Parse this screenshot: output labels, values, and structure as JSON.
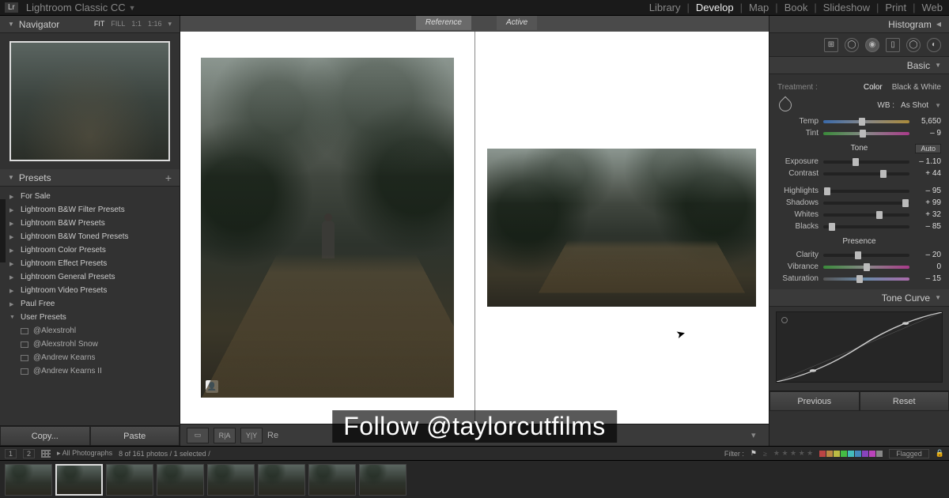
{
  "app_title": "Lightroom Classic CC",
  "modules": [
    "Library",
    "Develop",
    "Map",
    "Book",
    "Slideshow",
    "Print",
    "Web"
  ],
  "active_module": "Develop",
  "navigator": {
    "title": "Navigator",
    "zoom_opts": [
      "FIT",
      "FILL",
      "1:1",
      "1:16"
    ],
    "zoom_active": "FIT"
  },
  "presets": {
    "title": "Presets",
    "folders": [
      "For Sale",
      "Lightroom B&W Filter Presets",
      "Lightroom B&W Presets",
      "Lightroom B&W Toned Presets",
      "Lightroom Color Presets",
      "Lightroom Effect Presets",
      "Lightroom General Presets",
      "Lightroom Video Presets",
      "Paul Free"
    ],
    "user_folder": "User Presets",
    "user_items": [
      "@Alexstrohl",
      "@Alexstrohl Snow",
      "@Andrew Kearns",
      "@Andrew Kearns II"
    ]
  },
  "left_buttons": {
    "copy": "Copy...",
    "paste": "Paste"
  },
  "compare_tabs": {
    "reference": "Reference",
    "active": "Active"
  },
  "center_toolbar": {
    "re_label": "Re"
  },
  "histogram_title": "Histogram",
  "basic": {
    "title": "Basic",
    "treatment_label": "Treatment :",
    "treatment_opts": [
      "Color",
      "Black & White"
    ],
    "treatment_active": "Color",
    "wb_label": "WB :",
    "wb_value": "As Shot",
    "temp": {
      "label": "Temp",
      "value": "5,650",
      "pos": 45
    },
    "tint": {
      "label": "Tint",
      "value": "– 9",
      "pos": 46
    },
    "tone_label": "Tone",
    "auto_label": "Auto",
    "exposure": {
      "label": "Exposure",
      "value": "– 1.10",
      "pos": 38
    },
    "contrast": {
      "label": "Contrast",
      "value": "+ 44",
      "pos": 70
    },
    "highlights": {
      "label": "Highlights",
      "value": "– 95",
      "pos": 5
    },
    "shadows": {
      "label": "Shadows",
      "value": "+ 99",
      "pos": 95
    },
    "whites": {
      "label": "Whites",
      "value": "+ 32",
      "pos": 65
    },
    "blacks": {
      "label": "Blacks",
      "value": "– 85",
      "pos": 10
    },
    "presence_label": "Presence",
    "clarity": {
      "label": "Clarity",
      "value": "– 20",
      "pos": 40
    },
    "vibrance": {
      "label": "Vibrance",
      "value": "0",
      "pos": 50
    },
    "saturation": {
      "label": "Saturation",
      "value": "– 15",
      "pos": 42
    }
  },
  "tone_curve_title": "Tone Curve",
  "right_buttons": {
    "previous": "Previous",
    "reset": "Reset"
  },
  "secbar": {
    "pages": [
      "1",
      "2"
    ],
    "collection": "All Photographs",
    "count": "8 of 161 photos / 1 selected /",
    "filter_label": "Filter :",
    "flag_label": "Flagged"
  },
  "swatch_colors": [
    "#b44",
    "#b84",
    "#bb4",
    "#4b4",
    "#4bb",
    "#48b",
    "#84b",
    "#b4b",
    "#888"
  ],
  "overlay_text": "Follow @taylorcutfilms",
  "filmstrip_count": 8,
  "filmstrip_selected": 1
}
